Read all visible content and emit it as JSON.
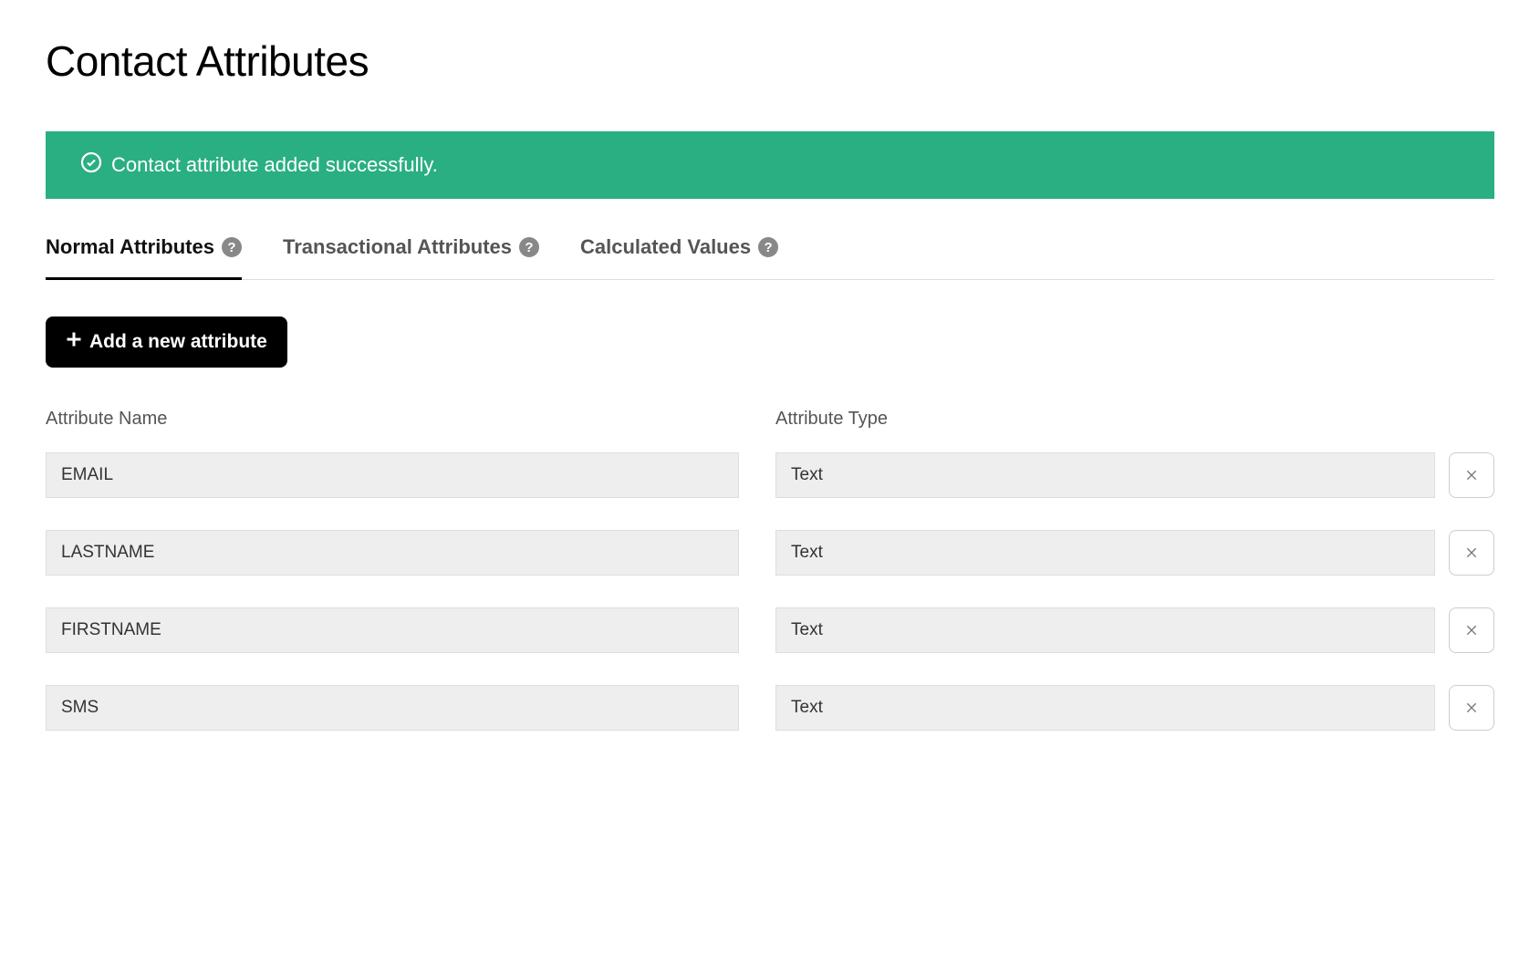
{
  "page": {
    "title": "Contact Attributes"
  },
  "alert": {
    "message": "Contact attribute added successfully."
  },
  "tabs": {
    "normal": "Normal Attributes",
    "transactional": "Transactional Attributes",
    "calculated": "Calculated Values"
  },
  "buttons": {
    "add": "Add a new attribute"
  },
  "columns": {
    "name": "Attribute Name",
    "type": "Attribute Type"
  },
  "attributes": [
    {
      "name": "EMAIL",
      "type": "Text"
    },
    {
      "name": "LASTNAME",
      "type": "Text"
    },
    {
      "name": "FIRSTNAME",
      "type": "Text"
    },
    {
      "name": "SMS",
      "type": "Text"
    }
  ]
}
